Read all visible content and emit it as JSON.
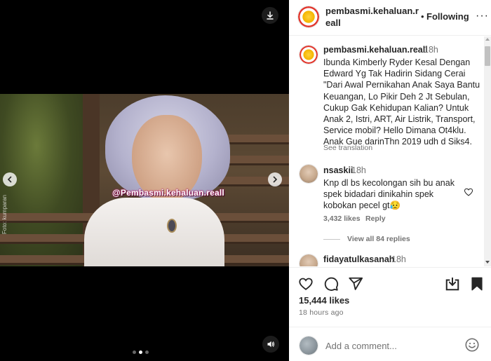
{
  "media": {
    "watermark": "@Pembasmi.kehaluan.reall",
    "credit": "Foto: kumparan",
    "slide_count": 3,
    "active_slide": 2
  },
  "header": {
    "username": "pembasmi.kehaluan.reall",
    "separator": "•",
    "follow_label": "Following",
    "more_label": "···"
  },
  "caption": {
    "username": "pembasmi.kehaluan.reall",
    "time": "18h",
    "text": "Ibunda Kimberly Ryder Kesal Dengan\nEdward Yg Tak Hadirin Sidang Cerai\n\"Dari Awal Pernikahan Anak Saya Bantu\nKeuangan, Lo Pikir Deh 2 Jt Sebulan,\nCukup Gak Kehidupan Kalian? Untuk\nAnak 2, Istri, ART, Air Listrik, Transport,\nService mobil? Hello Dimana Ot4klu.\nAnak Gue darinThn 2019 udh d Siks4.",
    "see_translation": "See translation"
  },
  "comments": [
    {
      "username": "nsaskii",
      "time": "18h",
      "text": "Knp dl bs kecolongan sih bu anak\nspek bidadari dinikahin spek\nkobokan pecel gt😥",
      "likes": "3,432 likes",
      "reply_label": "Reply",
      "view_replies": "View all 84 replies"
    },
    {
      "username": "fidayatulkasanah",
      "time": "18h"
    }
  ],
  "footer": {
    "likes": "15,444 likes",
    "time_ago": "18 hours ago",
    "comment_placeholder": "Add a comment..."
  },
  "icons": {
    "download": "download-icon",
    "sound": "speaker-icon",
    "prev": "chevron-left-icon",
    "next": "chevron-right-icon",
    "like": "heart-icon",
    "comment": "comment-bubble-icon",
    "share": "paper-plane-icon",
    "save_to_device": "download-tray-icon",
    "bookmark": "bookmark-icon",
    "emoji": "smiley-icon"
  }
}
